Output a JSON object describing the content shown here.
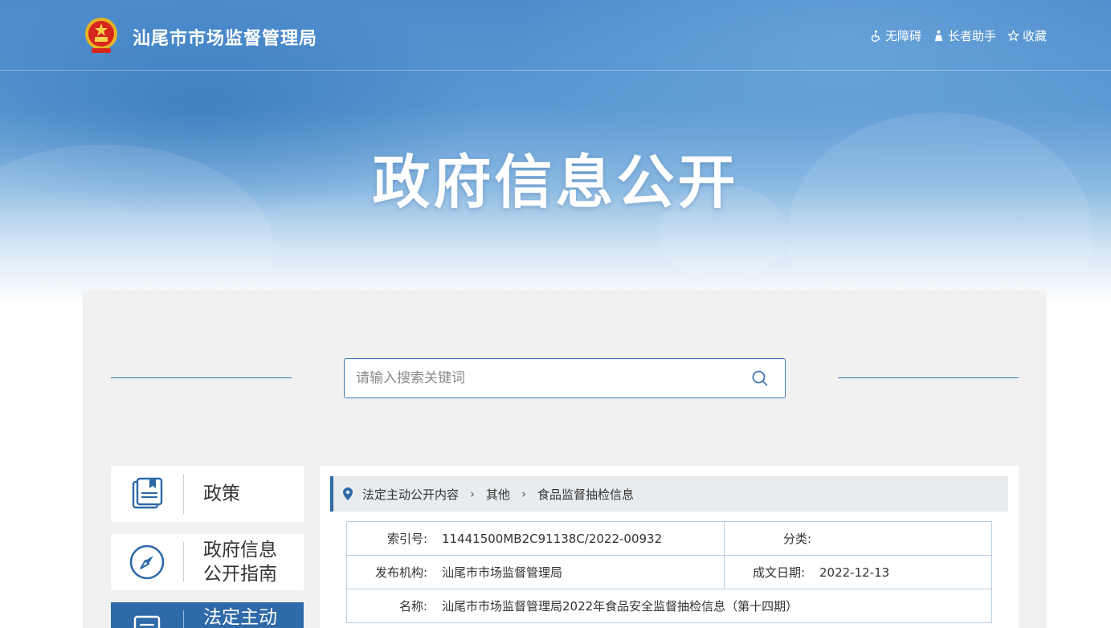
{
  "header": {
    "site_name": "汕尾市市场监督管理局",
    "tools": [
      {
        "icon": "wheelchair-icon",
        "label": "无障碍"
      },
      {
        "icon": "elder-icon",
        "label": "长者助手"
      },
      {
        "icon": "star-icon",
        "label": "收藏"
      }
    ]
  },
  "hero": {
    "title": "政府信息公开"
  },
  "search": {
    "placeholder": "请输入搜索关键词",
    "value": ""
  },
  "nav": [
    {
      "icon": "book-icon",
      "label": "政策"
    },
    {
      "icon": "compass-icon",
      "label": "政府信息\n公开指南"
    },
    {
      "icon": "document-icon",
      "label": "法定主动",
      "active": true
    }
  ],
  "breadcrumb": [
    "法定主动公开内容",
    "其他",
    "食品监督抽检信息"
  ],
  "meta": {
    "index_label": "索引号:",
    "index_value": "11441500MB2C91138C/2022-00932",
    "category_label": "分类:",
    "category_value": "",
    "publisher_label": "发布机构:",
    "publisher_value": "汕尾市市场监督管理局",
    "date_label": "成文日期:",
    "date_value": "2022-12-13",
    "name_label": "名称:",
    "name_value": "汕尾市市场监督管理局2022年食品安全监督抽检信息（第十四期）"
  },
  "colors": {
    "primary": "#2f6aa8",
    "line": "#3d78b2",
    "panel": "#f1f1f1"
  }
}
